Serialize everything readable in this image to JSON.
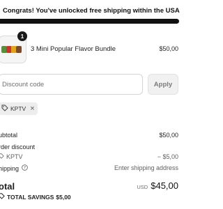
{
  "banner": {
    "message": "Congrats! You've unlocked free shipping within the USA",
    "progress": 1.0
  },
  "cart": {
    "items": [
      {
        "name": "3 Mini Popular Flavor Bundle",
        "quantity": "1",
        "price": "$50,00"
      }
    ]
  },
  "discount": {
    "placeholder": "Discount code",
    "value": "",
    "apply_label": "Apply",
    "applied_code": "KPTV"
  },
  "summary": {
    "subtotal_label": "ubtotal",
    "subtotal_value": "$50,00",
    "order_discount_label": "rder discount",
    "discount_code": "KPTV",
    "discount_value": "− $5,00",
    "shipping_label": "hipping",
    "shipping_value": "Enter shipping address",
    "total_label": "otal",
    "currency": "USD",
    "total_value": "$45,00",
    "total_savings_label": "TOTAL SAVINGS",
    "total_savings_value": "$5,00"
  },
  "icons": [
    "tag-icon",
    "close-icon",
    "help-circle-icon"
  ]
}
